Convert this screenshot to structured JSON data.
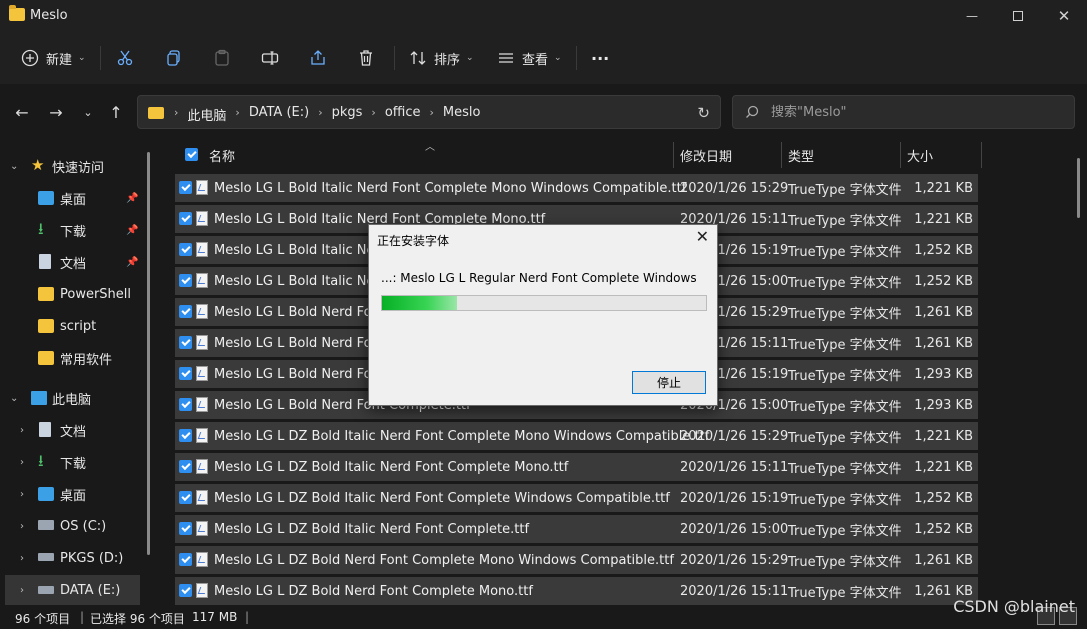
{
  "window": {
    "title": "Meslo"
  },
  "toolbar": {
    "new_label": "新建",
    "sort_label": "排序",
    "view_label": "查看",
    "more_label": "···"
  },
  "address": {
    "crumbs": [
      "此电脑",
      "DATA (E:)",
      "pkgs",
      "office",
      "Meslo"
    ],
    "search_placeholder": "搜索\"Meslo\""
  },
  "sidebar": {
    "quick_access": "快速访问",
    "quick_items": [
      "桌面",
      "下载",
      "文档",
      "PowerShell",
      "script",
      "常用软件"
    ],
    "this_pc": "此电脑",
    "pc_items": [
      "文档",
      "下载",
      "桌面",
      "OS (C:)",
      "PKGS (D:)",
      "DATA (E:)"
    ]
  },
  "columns": {
    "name": "名称",
    "date": "修改日期",
    "type": "类型",
    "size": "大小"
  },
  "files": [
    {
      "name": "Meslo LG L Bold Italic Nerd Font Complete Mono Windows Compatible.ttf",
      "date": "2020/1/26 15:29",
      "type": "TrueType 字体文件",
      "size": "1,221 KB"
    },
    {
      "name": "Meslo LG L Bold Italic Nerd Font Complete Mono.ttf",
      "date": "2020/1/26 15:11",
      "type": "TrueType 字体文件",
      "size": "1,221 KB"
    },
    {
      "name": "Meslo LG L Bold Italic Ner",
      "date": "2020/1/26 15:19",
      "type": "TrueType 字体文件",
      "size": "1,252 KB"
    },
    {
      "name": "Meslo LG L Bold Italic Ner",
      "date": "2020/1/26 15:00",
      "type": "TrueType 字体文件",
      "size": "1,252 KB"
    },
    {
      "name": "Meslo LG L Bold Nerd Fon",
      "date": "2020/1/26 15:29",
      "type": "TrueType 字体文件",
      "size": "1,261 KB"
    },
    {
      "name": "Meslo LG L Bold Nerd Fon",
      "date": "2020/1/26 15:11",
      "type": "TrueType 字体文件",
      "size": "1,261 KB"
    },
    {
      "name": "Meslo LG L Bold Nerd Fon",
      "date": "2020/1/26 15:19",
      "type": "TrueType 字体文件",
      "size": "1,293 KB"
    },
    {
      "name": "Meslo LG L Bold Nerd Font Complete.ttf",
      "date": "2020/1/26 15:00",
      "type": "TrueType 字体文件",
      "size": "1,293 KB"
    },
    {
      "name": "Meslo LG L DZ Bold Italic Nerd Font Complete Mono Windows Compatible.ttf",
      "date": "2020/1/26 15:29",
      "type": "TrueType 字体文件",
      "size": "1,221 KB"
    },
    {
      "name": "Meslo LG L DZ Bold Italic Nerd Font Complete Mono.ttf",
      "date": "2020/1/26 15:11",
      "type": "TrueType 字体文件",
      "size": "1,221 KB"
    },
    {
      "name": "Meslo LG L DZ Bold Italic Nerd Font Complete Windows Compatible.ttf",
      "date": "2020/1/26 15:19",
      "type": "TrueType 字体文件",
      "size": "1,252 KB"
    },
    {
      "name": "Meslo LG L DZ Bold Italic Nerd Font Complete.ttf",
      "date": "2020/1/26 15:00",
      "type": "TrueType 字体文件",
      "size": "1,252 KB"
    },
    {
      "name": "Meslo LG L DZ Bold Nerd Font Complete Mono Windows Compatible.ttf",
      "date": "2020/1/26 15:29",
      "type": "TrueType 字体文件",
      "size": "1,261 KB"
    },
    {
      "name": "Meslo LG L DZ Bold Nerd Font Complete Mono.ttf",
      "date": "2020/1/26 15:11",
      "type": "TrueType 字体文件",
      "size": "1,261 KB"
    }
  ],
  "status": {
    "count": "96 个项目",
    "selected": "已选择 96 个项目",
    "size": "117 MB"
  },
  "dialog": {
    "title": "正在安装字体",
    "message": "...: Meslo LG L Regular Nerd Font Complete Windows",
    "progress_fraction": 0.23,
    "stop_label": "停止"
  },
  "watermark": "CSDN @blainet"
}
